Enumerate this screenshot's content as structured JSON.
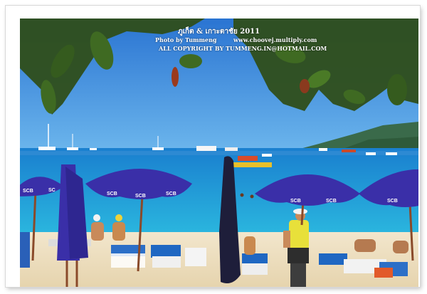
{
  "watermark": {
    "title": "ภูเก็ต & เกาะตาชัย 2011",
    "photo_credit": "Photo by Tummeng",
    "website": "www.choovej.multiply.com",
    "copyright": "ALL COPYRIGHT BY TUMMENG.IN@HOTMAIL.COM"
  },
  "umbrella_brand": "SCB",
  "colors": {
    "sky": "#3d8fdc",
    "sea": "#1fa3dc",
    "sand": "#efe3c8",
    "umbrella": "#3a2fa8",
    "leaves": "#2f4e1a",
    "shirt": "#e8e03a"
  }
}
